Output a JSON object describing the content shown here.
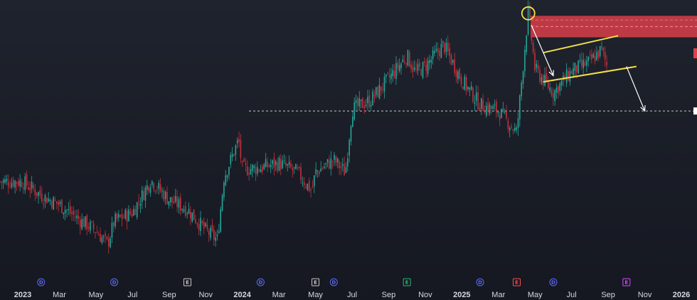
{
  "colors": {
    "background": "#1b1e27",
    "up": "#26a69a",
    "down": "#c6303c",
    "annotation": "#f2e04a",
    "arrow": "#ffffff",
    "zone": "#e0404a",
    "axis_text": "#d6d8de"
  },
  "chart_data": {
    "type": "candlestick",
    "title": "",
    "x_axis": {
      "ticks": [
        "2023",
        "Mar",
        "May",
        "Jul",
        "Sep",
        "Nov",
        "2024",
        "Mar",
        "May",
        "Jul",
        "Sep",
        "Nov",
        "2025",
        "Mar",
        "May",
        "Jul",
        "Sep",
        "Nov",
        "2026"
      ],
      "bold_ticks": [
        "2023",
        "2024",
        "2025",
        "2026"
      ],
      "range": [
        "2023-01",
        "2026-01"
      ]
    },
    "y_axis": {
      "visible": false,
      "range": [
        0,
        100
      ]
    },
    "grid": false,
    "price_path": [
      {
        "date": "2023-01",
        "value": 54
      },
      {
        "date": "2023-02",
        "value": 45
      },
      {
        "date": "2023-03",
        "value": 39
      },
      {
        "date": "2023-04",
        "value": 30
      },
      {
        "date": "2023-05",
        "value": 22
      },
      {
        "date": "2023-05-20",
        "value": 13
      },
      {
        "date": "2023-06",
        "value": 28
      },
      {
        "date": "2023-07",
        "value": 34
      },
      {
        "date": "2023-08",
        "value": 55
      },
      {
        "date": "2023-09",
        "value": 42
      },
      {
        "date": "2023-10",
        "value": 36
      },
      {
        "date": "2023-11",
        "value": 22
      },
      {
        "date": "2023-11-20",
        "value": 16
      },
      {
        "date": "2023-12",
        "value": 57
      },
      {
        "date": "2023-12-25",
        "value": 81
      },
      {
        "date": "2024-01",
        "value": 62
      },
      {
        "date": "2024-02",
        "value": 63
      },
      {
        "date": "2024-03",
        "value": 66
      },
      {
        "date": "2024-04",
        "value": 60
      },
      {
        "date": "2024-04-25",
        "value": 48
      },
      {
        "date": "2024-05",
        "value": 60
      },
      {
        "date": "2024-06",
        "value": 68
      },
      {
        "date": "2024-06-20",
        "value": 60
      },
      {
        "date": "2024-07",
        "value": 101
      },
      {
        "date": "2024-08",
        "value": 107
      },
      {
        "date": "2024-09",
        "value": 121
      },
      {
        "date": "2024-10",
        "value": 136
      },
      {
        "date": "2024-10-15",
        "value": 125
      },
      {
        "date": "2024-11",
        "value": 129
      },
      {
        "date": "2024-12",
        "value": 143
      },
      {
        "date": "2025-01",
        "value": 120
      },
      {
        "date": "2025-02",
        "value": 104
      },
      {
        "date": "2025-03",
        "value": 100
      },
      {
        "date": "2025-04",
        "value": 86
      },
      {
        "date": "2025-04-20",
        "value": 165
      },
      {
        "date": "2025-05",
        "value": 127
      },
      {
        "date": "2025-06",
        "value": 112
      },
      {
        "date": "2025-07",
        "value": 126
      },
      {
        "date": "2025-08",
        "value": 132
      },
      {
        "date": "2025-08-20",
        "value": 140
      },
      {
        "date": "2025-09",
        "value": 127
      }
    ],
    "events": [
      {
        "date": "2023-02",
        "letter": "D",
        "color": "#5b6bff"
      },
      {
        "date": "2023-06",
        "letter": "D",
        "color": "#5b6bff"
      },
      {
        "date": "2023-10",
        "letter": "E",
        "color": "#c9c9c9"
      },
      {
        "date": "2024-02",
        "letter": "D",
        "color": "#5b6bff"
      },
      {
        "date": "2024-05",
        "letter": "E",
        "color": "#c9c9c9"
      },
      {
        "date": "2024-06",
        "letter": "D",
        "color": "#5b6bff"
      },
      {
        "date": "2024-10",
        "letter": "E",
        "color": "#2bb673"
      },
      {
        "date": "2025-02",
        "letter": "D",
        "color": "#5b6bff"
      },
      {
        "date": "2025-04",
        "letter": "E",
        "color": "#ff4b4b"
      },
      {
        "date": "2025-06",
        "letter": "D",
        "color": "#5b6bff"
      },
      {
        "date": "2025-10",
        "letter": "E",
        "color": "#d14bff"
      }
    ],
    "annotations": {
      "horizontal_level": 100,
      "resistance_zone": [
        148,
        162
      ],
      "highlight_circle": {
        "date": "2025-04-20",
        "value": 165
      },
      "channel_upper": [
        {
          "date": "2025-06",
          "value": 138
        },
        {
          "date": "2025-09",
          "value": 149
        }
      ],
      "channel_lower": [
        {
          "date": "2025-06",
          "value": 119
        },
        {
          "date": "2025-10",
          "value": 129
        }
      ],
      "arrows": [
        {
          "from": {
            "date": "2025-04-25",
            "value": 156
          },
          "to": {
            "date": "2025-06",
            "value": 123
          }
        },
        {
          "from": {
            "date": "2025-10",
            "value": 129
          },
          "to": {
            "date": "2025-11",
            "value": 100
          }
        }
      ]
    }
  }
}
